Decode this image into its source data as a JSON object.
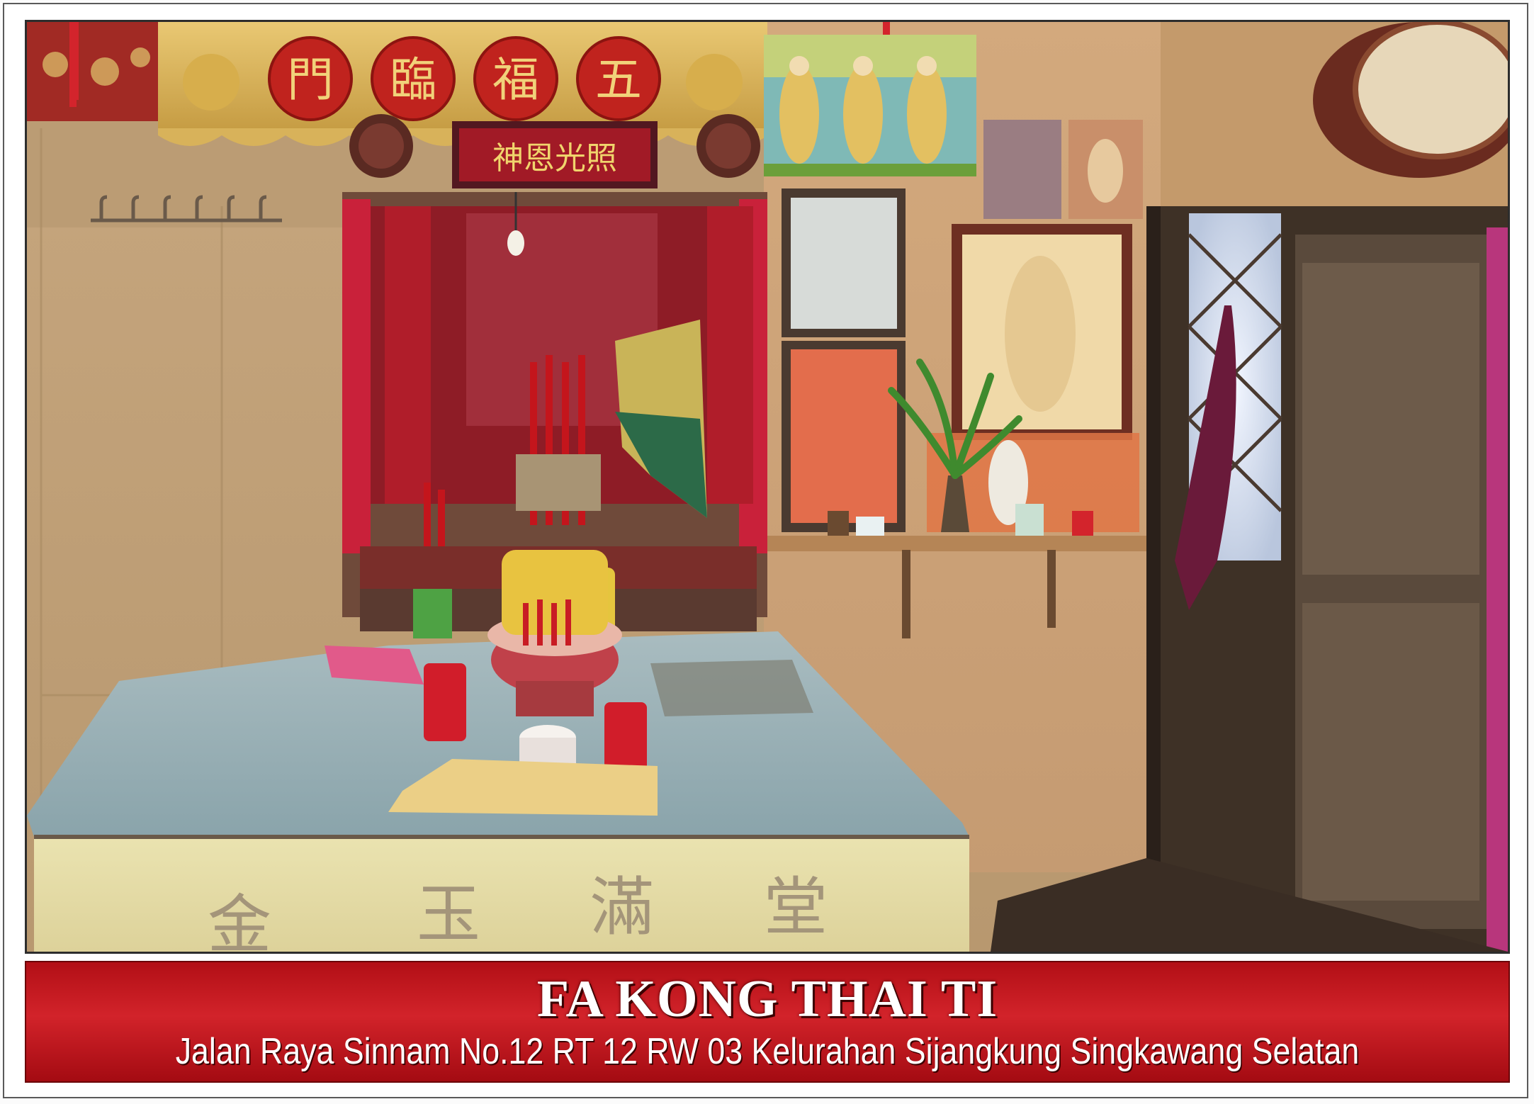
{
  "caption": {
    "title": "FA KONG THAI TI",
    "address": "Jalan Raya Sinnam No.12 RT 12 RW 03 Kelurahan Sijangkung Singkawang Selatan"
  },
  "photo": {
    "banner_characters": [
      "五",
      "福",
      "臨",
      "門"
    ],
    "plaque_text": "神恩光照",
    "altar_cloth_characters": [
      "金",
      "玉",
      "滿",
      "堂"
    ],
    "colors": {
      "caption_red": "#c8161d",
      "wall_tan": "#c9ad86",
      "altar_blue": "#9eb3b8",
      "altar_cloth_yellow": "#e8dfa8",
      "shrine_red": "#8e1c26"
    }
  }
}
